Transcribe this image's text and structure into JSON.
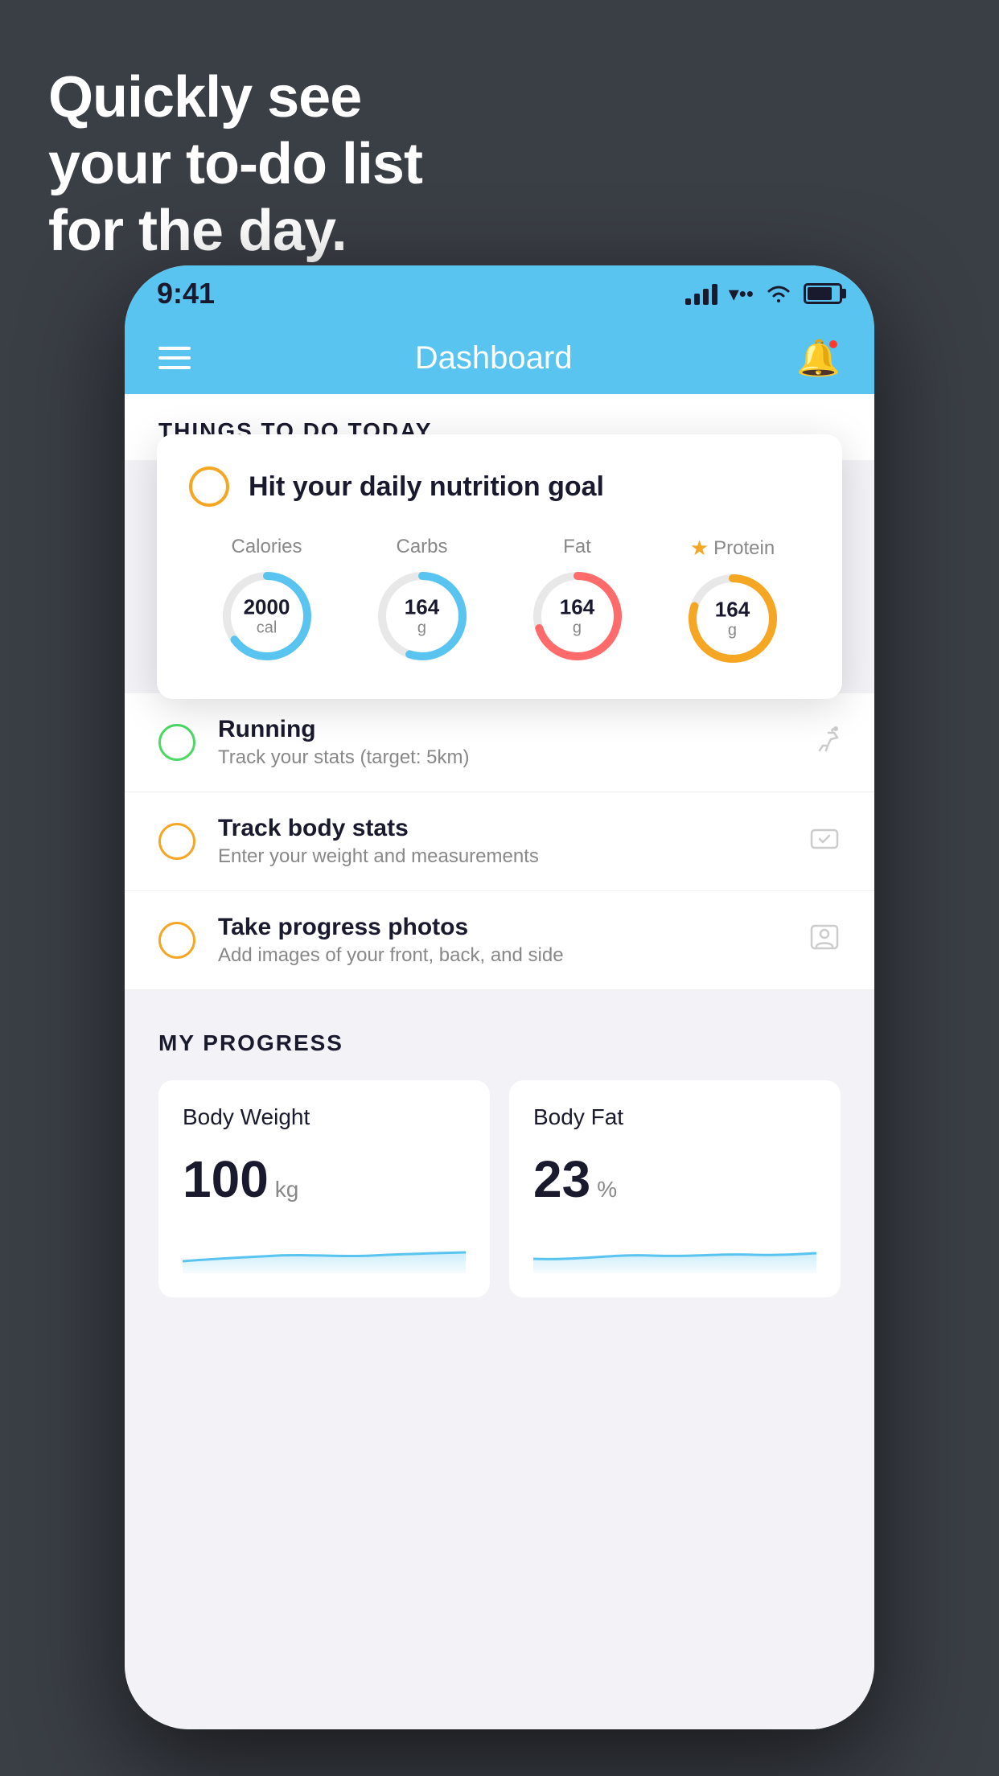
{
  "hero": {
    "line1": "Quickly see",
    "line2": "your to-do list",
    "line3": "for the day."
  },
  "status_bar": {
    "time": "9:41",
    "signal_bars": [
      8,
      14,
      20,
      26
    ],
    "battery_percent": 80
  },
  "nav": {
    "title": "Dashboard"
  },
  "things_section": {
    "heading": "THINGS TO DO TODAY"
  },
  "floating_card": {
    "title": "Hit your daily nutrition goal",
    "items": [
      {
        "label": "Calories",
        "value": "2000",
        "unit": "cal",
        "color": "#5ac4f0",
        "percent": 65,
        "star": false
      },
      {
        "label": "Carbs",
        "value": "164",
        "unit": "g",
        "color": "#5ac4f0",
        "percent": 55,
        "star": false
      },
      {
        "label": "Fat",
        "value": "164",
        "unit": "g",
        "color": "#ff6b6b",
        "percent": 70,
        "star": false
      },
      {
        "label": "Protein",
        "value": "164",
        "unit": "g",
        "color": "#f5a623",
        "percent": 80,
        "star": true
      }
    ]
  },
  "todo_items": [
    {
      "label": "Running",
      "sublabel": "Track your stats (target: 5km)",
      "circle_color": "green",
      "icon": "👟"
    },
    {
      "label": "Track body stats",
      "sublabel": "Enter your weight and measurements",
      "circle_color": "yellow",
      "icon": "⚖️"
    },
    {
      "label": "Take progress photos",
      "sublabel": "Add images of your front, back, and side",
      "circle_color": "yellow2",
      "icon": "👤"
    }
  ],
  "progress_section": {
    "title": "MY PROGRESS",
    "cards": [
      {
        "title": "Body Weight",
        "value": "100",
        "unit": "kg"
      },
      {
        "title": "Body Fat",
        "value": "23",
        "unit": "%"
      }
    ]
  }
}
